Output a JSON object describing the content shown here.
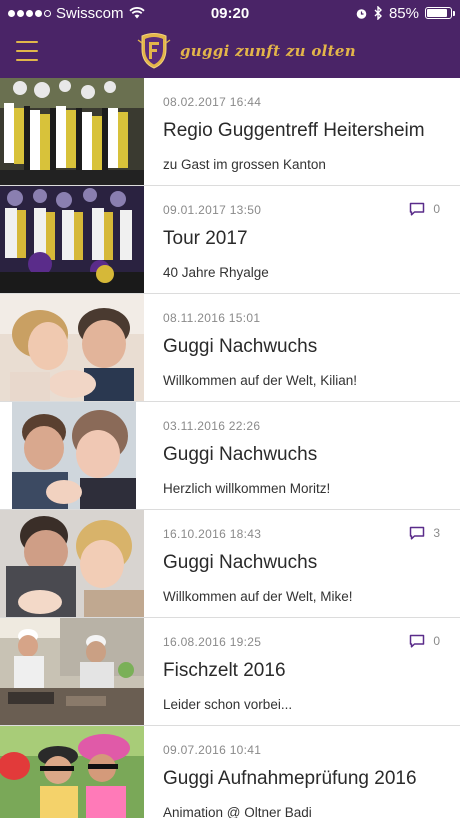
{
  "status_bar": {
    "carrier": "Swisscom",
    "time": "09:20",
    "battery": "85%",
    "battery_level": 0.85
  },
  "header": {
    "brand": "guggi zunft zu olten",
    "accent_color": "#4a2467",
    "gold_color": "#e3b54a"
  },
  "posts": [
    {
      "date": "08.02.2017 16:44",
      "title": "Regio Guggentreff Heitersheim",
      "subtitle": "zu Gast im grossen Kanton",
      "comments": ""
    },
    {
      "date": "09.01.2017 13:50",
      "title": "Tour 2017",
      "subtitle": "40 Jahre Rhyalge",
      "comments": "0"
    },
    {
      "date": "08.11.2016 15:01",
      "title": "Guggi Nachwuchs",
      "subtitle": "Willkommen auf der Welt, Kilian!",
      "comments": ""
    },
    {
      "date": "03.11.2016 22:26",
      "title": "Guggi Nachwuchs",
      "subtitle": "Herzlich willkommen Moritz!",
      "comments": ""
    },
    {
      "date": "16.10.2016 18:43",
      "title": "Guggi Nachwuchs",
      "subtitle": "Willkommen auf der Welt, Mike!",
      "comments": "3"
    },
    {
      "date": "16.08.2016 19:25",
      "title": "Fischzelt 2016",
      "subtitle": "Leider schon vorbei...",
      "comments": "0"
    },
    {
      "date": "09.07.2016 10:41",
      "title": "Guggi Aufnahmeprüfung 2016",
      "subtitle": "Animation @ Oltner Badi",
      "comments": ""
    }
  ]
}
